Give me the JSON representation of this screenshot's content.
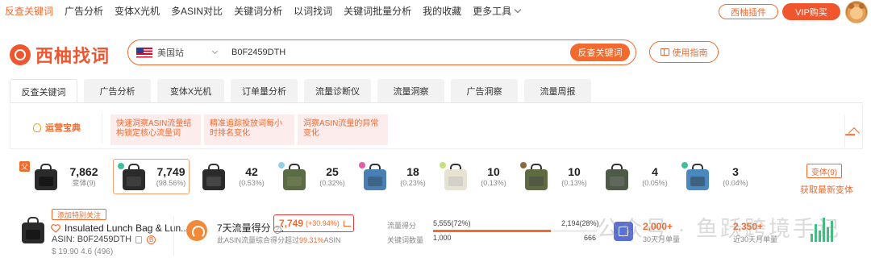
{
  "topnav": {
    "items": [
      "反查关键词",
      "广告分析",
      "变体X光机",
      "多ASIN对比",
      "关键词分析",
      "以词找词",
      "关键词批量分析",
      "我的收藏",
      "更多工具"
    ],
    "plugin_label": "西柚插件",
    "vip_label": "VIP购买"
  },
  "brand": {
    "name": "西柚找词"
  },
  "search": {
    "site": "美国站",
    "value": "B0F2459DTH",
    "button_label": "反查关键词",
    "guide_label": "使用指南"
  },
  "tabs": [
    "反查关键词",
    "广告分析",
    "变体X光机",
    "订单量分析",
    "流量诊断仪",
    "流量洞察",
    "广告洞察",
    "流量周报"
  ],
  "ops": {
    "title": "运营宝典",
    "cards": [
      "快速洞察ASIN流量结构锁定核心流量词",
      "精准追踪投放词每小时排名变化",
      "洞察ASIN流量的异常变化"
    ]
  },
  "variants": {
    "corner_badge": "父",
    "summary": {
      "count": "7,862",
      "label": "变体(9)"
    },
    "items": [
      {
        "value": "7,749",
        "pct": "(98.56%)",
        "dot": "#3fbf9f",
        "color": "#2b2b2b",
        "pocket": "#555"
      },
      {
        "value": "42",
        "pct": "(0.53%)",
        "dot": "",
        "color": "#2b2b2b",
        "pocket": "#666"
      },
      {
        "value": "25",
        "pct": "(0.32%)",
        "dot": "#8fd2e8",
        "color": "#5b6b45",
        "pocket": "#7a8a5a"
      },
      {
        "value": "18",
        "pct": "(0.23%)",
        "dot": "#e65aa8",
        "color": "#4a7fb5",
        "pocket": "#345"
      },
      {
        "value": "10",
        "pct": "(0.13%)",
        "dot": "#c6e07a",
        "color": "#e8e2d2",
        "pocket": "#bbb"
      },
      {
        "value": "10",
        "pct": "(0.13%)",
        "dot": "#8a6a3a",
        "color": "#5e6b40",
        "pocket": "#444"
      },
      {
        "value": "4",
        "pct": "(0.05%)",
        "dot": "",
        "color": "#4d5a48",
        "pocket": "#777"
      },
      {
        "value": "3",
        "pct": "(0.04%)",
        "dot": "#3fbf9f",
        "color": "#4a88c0",
        "pocket": "#333"
      }
    ],
    "variants_btn": "变体(9)",
    "fetch_latest": "获取最新变体"
  },
  "product": {
    "special_follow": "添加特别关注",
    "title": "Insulated Lunch Bag & Lun...",
    "asin": "ASIN: B0F2459DTH",
    "b_badge": "B",
    "price_rating": "$ 19.90 4.6 (496)"
  },
  "traffic": {
    "label": "7天流量得分",
    "value": "7,749",
    "change": "(+30.94%)",
    "sub_prefix": "此ASIN流量综合得分超过",
    "sub_pct": "99.31%",
    "sub_suffix": "ASIN",
    "share_label": "流量得分",
    "share_a": "5,555(72%)",
    "share_b": "2,194(28%)",
    "share_fill_pct": 72,
    "kw_label": "关键词数量",
    "kw_a": "1,000",
    "kw_b": "666"
  },
  "metrics": {
    "m1_value": "2,000+",
    "m1_label": "30天月单量",
    "m2_value": "2,350+",
    "m2_label": "近30天月单量"
  },
  "watermark": "公众号 · 鱼跃跨境手记"
}
